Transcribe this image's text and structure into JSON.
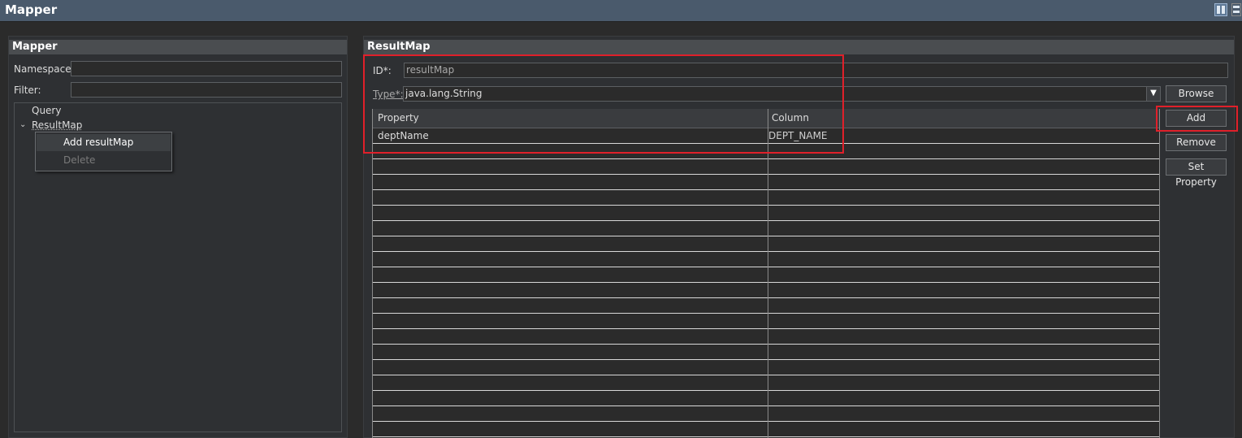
{
  "window": {
    "title": "Mapper"
  },
  "icons": {
    "layout_a": "columns-layout-icon",
    "layout_b": "rows-layout-icon"
  },
  "left": {
    "header": "Mapper",
    "namespace_label": "Namespace:",
    "namespace_value": "",
    "filter_label": "Filter:",
    "filter_value": "",
    "tree": [
      {
        "label": "Query",
        "expanded": false
      },
      {
        "label": "ResultMap",
        "expanded": true
      }
    ],
    "context_menu": [
      {
        "label": "Add resultMap",
        "enabled": true
      },
      {
        "label": "Delete",
        "enabled": false
      }
    ]
  },
  "right": {
    "header": "ResultMap",
    "id_label": "ID*:",
    "id_value": "resultMap",
    "type_label": "Type*:",
    "type_value": "java.lang.String",
    "browse_label": "Browse",
    "buttons": {
      "add": "Add",
      "remove": "Remove",
      "set_property": "Set Property"
    },
    "table": {
      "columns": [
        "Property",
        "Column"
      ],
      "rows": [
        {
          "property": "deptName",
          "column": "DEPT_NAME"
        }
      ]
    }
  },
  "colors": {
    "highlight": "#e0202a",
    "background": "#2b2b2b",
    "titlebar": "#4a5a6c"
  }
}
